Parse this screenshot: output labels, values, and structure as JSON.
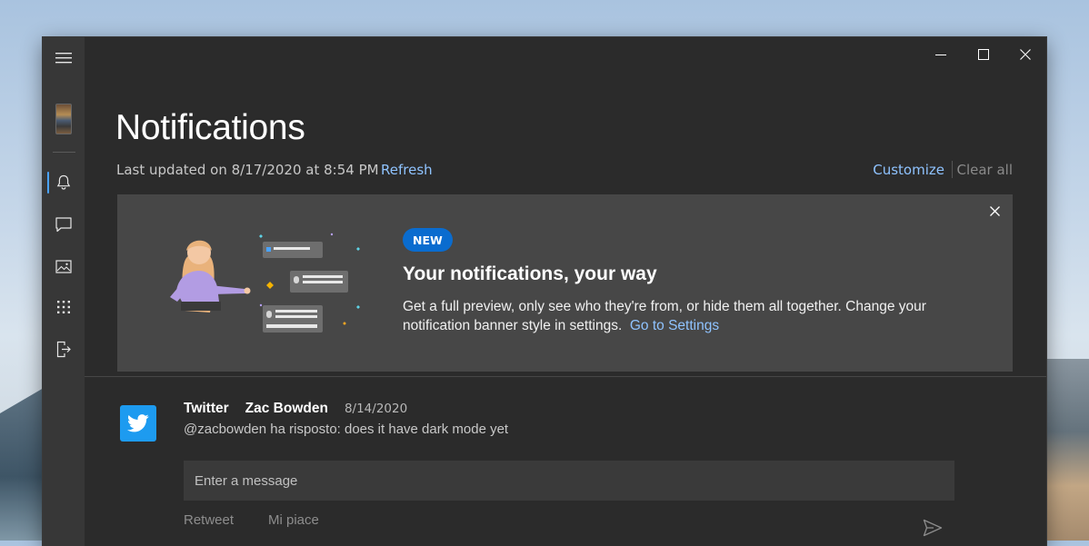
{
  "header": {
    "title": "Notifications",
    "last_updated": "Last updated on 8/17/2020 at 8:54 PM",
    "refresh_label": "Refresh",
    "customize_label": "Customize",
    "clear_all_label": "Clear all"
  },
  "banner": {
    "badge": "NEW",
    "title": "Your notifications, your way",
    "description": "Get a full preview, only see who they're from, or hide them all together. Change your notification banner style in settings.",
    "settings_link": "Go to Settings"
  },
  "notification": {
    "app": "Twitter",
    "sender": "Zac Bowden",
    "date": "8/14/2020",
    "message": "@zacbowden ha risposto: does it have dark mode yet",
    "reply_placeholder": "Enter a message",
    "actions": [
      "Retweet",
      "Mi piace"
    ]
  },
  "sidebar": {
    "items": [
      {
        "icon": "menu-icon"
      },
      {
        "icon": "phone-thumbnail"
      },
      {
        "icon": "bell-icon",
        "active": true
      },
      {
        "icon": "chat-icon"
      },
      {
        "icon": "photos-icon"
      },
      {
        "icon": "apps-grid-icon"
      },
      {
        "icon": "sign-out-icon"
      }
    ]
  },
  "colors": {
    "accent": "#4aa3ff",
    "link": "#8fc3ff",
    "badge": "#0a6ccf",
    "twitter": "#1d9bf0",
    "window_bg": "#2b2b2b",
    "sidebar_bg": "#373737",
    "banner_bg": "#474747"
  }
}
